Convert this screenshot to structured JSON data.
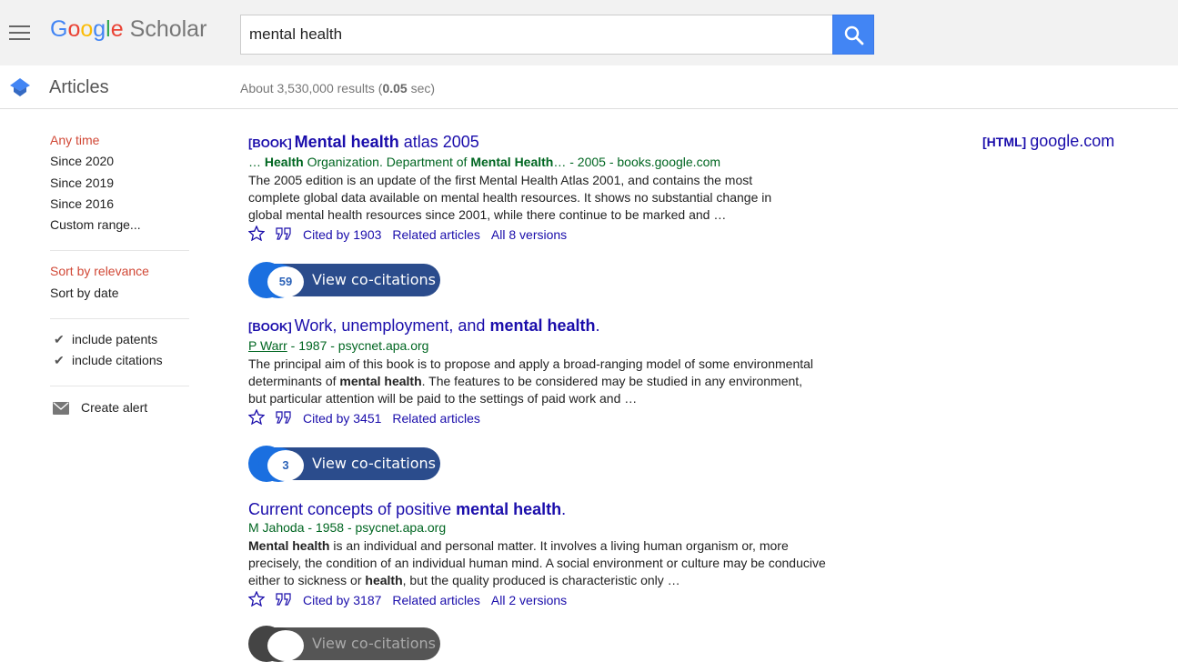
{
  "header": {
    "logo_letters": [
      "G",
      "o",
      "o",
      "g",
      "l",
      "e"
    ],
    "logo_product": "Scholar",
    "search_value": "mental health"
  },
  "subheader": {
    "section_label": "Articles",
    "results_prefix": "About 3,530,000 results (",
    "results_time": "0.05",
    "results_suffix": " sec)"
  },
  "sidebar": {
    "time_filters": [
      "Any time",
      "Since 2020",
      "Since 2019",
      "Since 2016",
      "Custom range..."
    ],
    "sort_options": [
      "Sort by relevance",
      "Sort by date"
    ],
    "checkboxes": [
      "include patents",
      "include citations"
    ],
    "alert_label": "Create alert"
  },
  "results": [
    {
      "tag": "[BOOK]",
      "title_bold": "Mental health",
      "title_rest": " atlas 2005",
      "meta": [
        "… ",
        "Health",
        " Organization. Department of ",
        "Mental Health",
        "… - 2005 - books.google.com"
      ],
      "snippet": "The 2005 edition is an update of the first Mental Health Atlas 2001, and contains the most complete global data available on mental health resources. It shows no substantial change in global mental health resources since 2001, while there continue to be marked and …",
      "cited_by": "Cited by 1903",
      "related": "Related articles",
      "versions": "All 8 versions",
      "cocitations": "59"
    },
    {
      "tag": "[BOOK]",
      "title_pre": "Work, unemployment, and ",
      "title_bold": "mental health",
      "title_post": ".",
      "author": "P Warr",
      "meta_rest": " - 1987 - psycnet.apa.org",
      "snippet": [
        "The principal aim of this book is to propose and apply a broad-ranging model of some environmental determinants of ",
        "mental health",
        ". The features to be considered may be studied in any environment, but particular attention will be paid to the settings of paid work and …"
      ],
      "cited_by": "Cited by 3451",
      "related": "Related articles",
      "cocitations": "3"
    },
    {
      "title_pre": "Current concepts of positive ",
      "title_bold": "mental health",
      "title_post": ".",
      "meta": "M Jahoda - 1958 - psycnet.apa.org",
      "snippet": [
        "Mental health",
        " is an individual and personal matter. It involves a living human organism or, more precisely, the condition of an individual human mind. A social environment or culture may be conducive either to sickness or ",
        "health",
        ", but the quality produced is characteristic only …"
      ],
      "cited_by": "Cited by 3187",
      "related": "Related articles",
      "versions": "All 2 versions"
    }
  ],
  "cocitation_label": "View co-citations",
  "side_link": {
    "tag": "[HTML]",
    "domain": "google.com"
  },
  "colors": {
    "link": "#1a0dab",
    "green": "#006621",
    "active": "#d14836",
    "search_blue": "#4285f4"
  }
}
